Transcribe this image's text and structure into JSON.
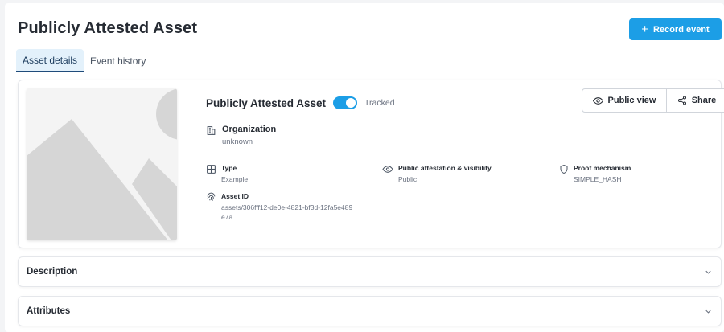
{
  "header": {
    "title": "Publicly Attested Asset",
    "record_button_label": "Record event"
  },
  "tabs": [
    {
      "label": "Asset details",
      "active": true
    },
    {
      "label": "Event history",
      "active": false
    }
  ],
  "asset": {
    "name": "Publicly Attested Asset",
    "tracked_label": "Tracked",
    "tracked": true,
    "public_view_label": "Public view",
    "share_label": "Share",
    "organization": {
      "label": "Organization",
      "value": "unknown"
    },
    "type": {
      "label": "Type",
      "value": "Example"
    },
    "visibility": {
      "label": "Public attestation & visibility",
      "value": "Public"
    },
    "proof": {
      "label": "Proof mechanism",
      "value": "SIMPLE_HASH"
    },
    "asset_id": {
      "label": "Asset ID",
      "value_line1": "assets/306fff12-de0e-4821-bf3d-12fa5e489",
      "value_line2": "e7a"
    }
  },
  "sections": {
    "description": "Description",
    "attributes": "Attributes"
  },
  "colors": {
    "accent": "#1c9ee6",
    "tab_active_bg": "#e3f1fb",
    "tab_active_border": "#1f4b7a"
  },
  "icons": [
    "plus-icon",
    "building-icon",
    "grid-icon",
    "eye-icon",
    "shield-icon",
    "fingerprint-icon",
    "share-icon",
    "chevron-down-icon",
    "image-placeholder-icon"
  ]
}
